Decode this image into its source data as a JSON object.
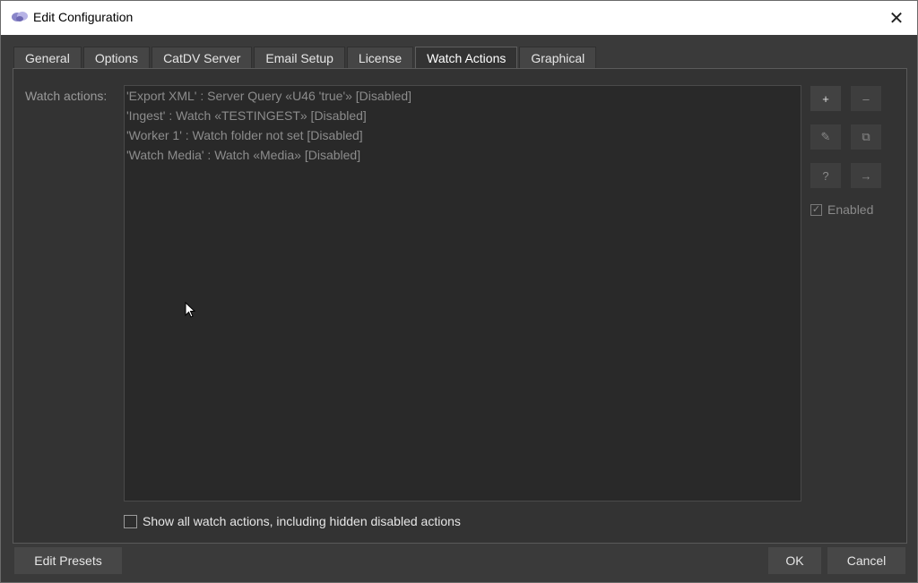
{
  "window": {
    "title": "Edit Configuration",
    "close_glyph": "✕"
  },
  "tabs": [
    {
      "label": "General",
      "active": false
    },
    {
      "label": "Options",
      "active": false
    },
    {
      "label": "CatDV Server",
      "active": false
    },
    {
      "label": "Email Setup",
      "active": false
    },
    {
      "label": "License",
      "active": false
    },
    {
      "label": "Watch Actions",
      "active": true
    },
    {
      "label": "Graphical",
      "active": false
    }
  ],
  "panel": {
    "watch_actions_label": "Watch actions:",
    "items": [
      "'Export XML' : Server Query «U46 'true'» [Disabled]",
      "'Ingest' : Watch «TESTINGEST» [Disabled]",
      "'Worker 1' : Watch folder not set [Disabled]",
      "'Watch Media' : Watch «Media» [Disabled]"
    ],
    "side_buttons": {
      "add": "+",
      "remove": "–",
      "edit": "✎",
      "duplicate": "⧉",
      "help": "?",
      "move": "→"
    },
    "enabled_label": "Enabled",
    "enabled_checked": true,
    "show_all_label": "Show all watch actions, including hidden disabled actions",
    "show_all_checked": false
  },
  "footer": {
    "edit_presets": "Edit Presets",
    "ok": "OK",
    "cancel": "Cancel"
  },
  "colors": {
    "background": "#3a3a3a",
    "panel": "#333333",
    "list": "#292929",
    "text": "#e6e6e6",
    "disabled_text": "#8c8c8c"
  }
}
